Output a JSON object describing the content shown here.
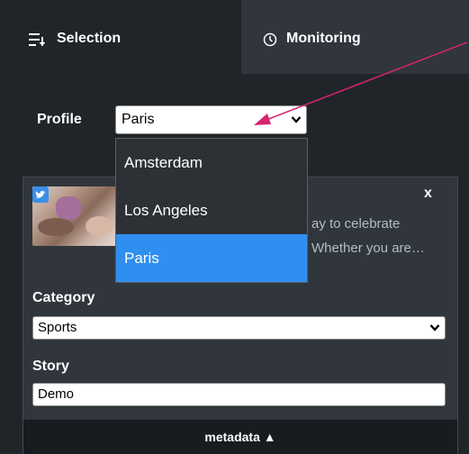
{
  "tabs": [
    {
      "label": "Selection",
      "icon": "sort-list-icon",
      "active": true
    },
    {
      "label": "Monitoring",
      "icon": "clock-icon",
      "active": false
    }
  ],
  "profile": {
    "label": "Profile",
    "value": "Paris",
    "options": [
      "Amsterdam",
      "Los Angeles",
      "Paris"
    ],
    "selected_index": 2
  },
  "card": {
    "close_label": "x",
    "description_line1": "ay to celebrate",
    "description_line2": "Whether you are…",
    "category_label": "Category",
    "category_value": "Sports",
    "story_label": "Story",
    "story_value": "Demo",
    "metadata_label": "metadata ▲"
  },
  "colors": {
    "background": "#20252a",
    "tab_inactive": "#30363c",
    "accent": "#2f8ff0",
    "annotation_arrow": "#d6246e",
    "twitter": "#3b8ee8"
  }
}
